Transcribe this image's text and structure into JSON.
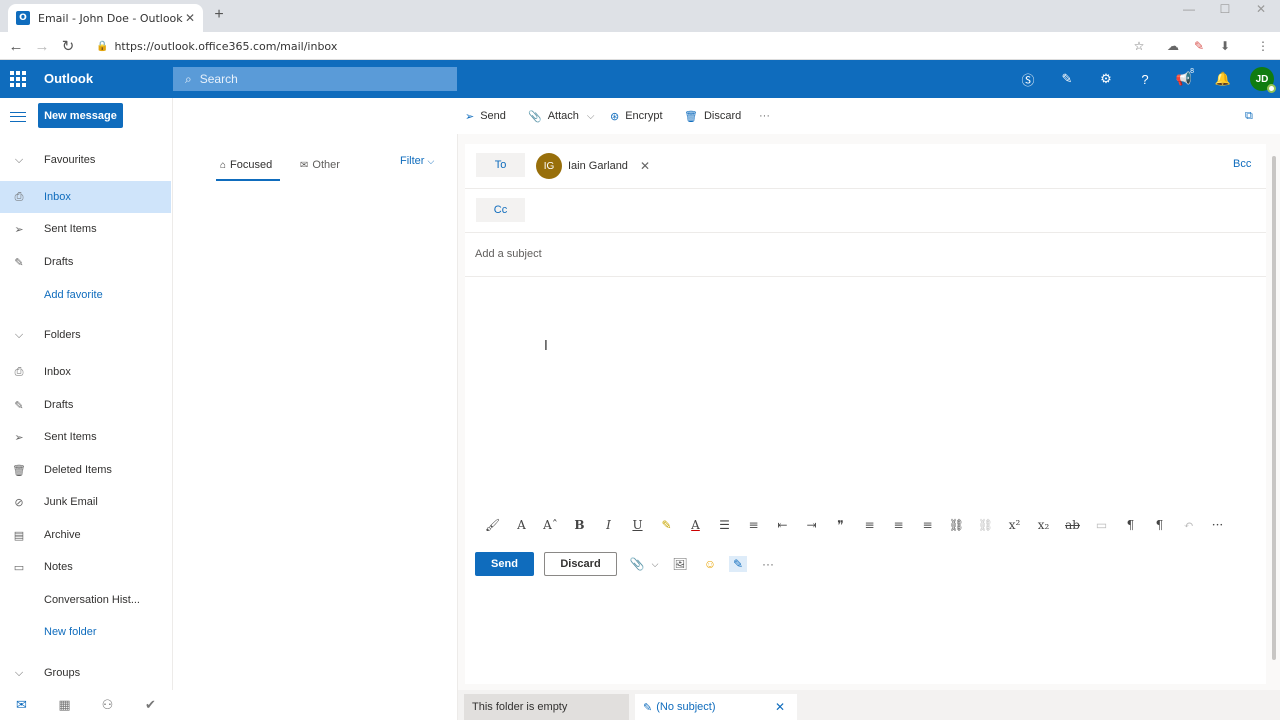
{
  "browser": {
    "tab_title": "Email - John Doe - Outlook",
    "tab_icon": "O",
    "url": "https://outlook.office365.com/mail/inbox"
  },
  "suite": {
    "app_name": "Outlook",
    "search_placeholder": "Search",
    "avatar_initials": "JD",
    "news_count": "8"
  },
  "nav": {
    "new_message": "New message",
    "favourites_header": "Favourites",
    "favourites": [
      {
        "label": "Inbox",
        "icon": "inbox-icon"
      },
      {
        "label": "Sent Items",
        "icon": "send-icon"
      },
      {
        "label": "Drafts",
        "icon": "pencil-icon"
      }
    ],
    "add_favorite": "Add favorite",
    "folders_header": "Folders",
    "folders": [
      {
        "label": "Inbox"
      },
      {
        "label": "Drafts"
      },
      {
        "label": "Sent Items"
      },
      {
        "label": "Deleted Items"
      },
      {
        "label": "Junk Email"
      },
      {
        "label": "Archive"
      },
      {
        "label": "Notes"
      },
      {
        "label": "Conversation Hist..."
      }
    ],
    "new_folder": "New folder",
    "groups_header": "Groups"
  },
  "list": {
    "tab_focused": "Focused",
    "tab_other": "Other",
    "filter": "Filter"
  },
  "commands": {
    "send": "Send",
    "attach": "Attach",
    "encrypt": "Encrypt",
    "discard": "Discard"
  },
  "compose": {
    "to_label": "To",
    "cc_label": "Cc",
    "bcc_label": "Bcc",
    "recipient_initials": "IG",
    "recipient_name": "Iain Garland",
    "subject_placeholder": "Add a subject",
    "send_button": "Send",
    "discard_button": "Discard"
  },
  "status": {
    "folder_empty": "This folder is empty",
    "draft_tab": "(No subject)"
  },
  "colors": {
    "accent": "#0f6cbd",
    "selected": "#cfe4fa",
    "recipient_avatar": "#986f0b",
    "user_avatar": "#107c10"
  }
}
